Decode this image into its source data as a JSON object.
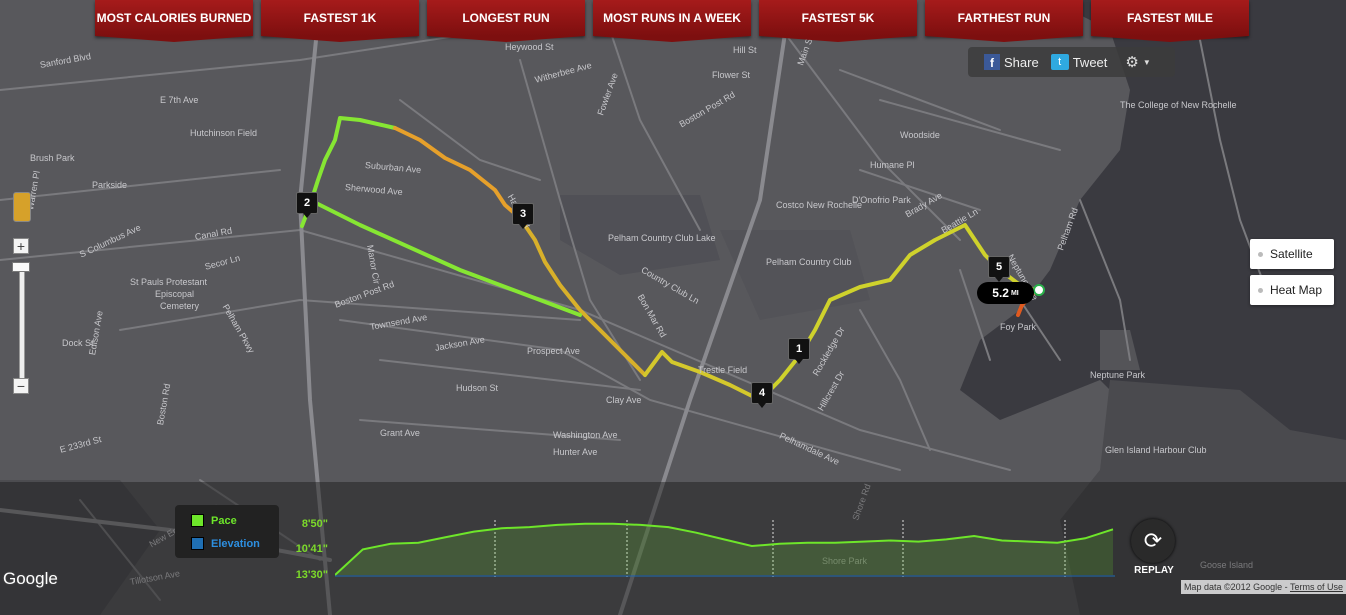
{
  "tabs": [
    "MOST CALORIES BURNED",
    "FASTEST 1K",
    "LONGEST RUN",
    "MOST RUNS IN A WEEK",
    "FASTEST 5K",
    "FARTHEST RUN",
    "FASTEST MILE"
  ],
  "share": {
    "facebook": "Share",
    "twitter": "Tweet"
  },
  "map_type": {
    "satellite": "Satellite",
    "heatmap": "Heat Map"
  },
  "zoom": {
    "plus": "+",
    "minus": "−"
  },
  "route": {
    "markers": [
      "1",
      "2",
      "3",
      "4",
      "5"
    ],
    "distance_value": "5.2",
    "distance_unit": "MI"
  },
  "map_labels": [
    "Sanford Blvd",
    "E 7th Ave",
    "Hutchinson Field",
    "Brush Park",
    "Parkside",
    "Warren Pl",
    "S Columbus Ave",
    "St Pauls Protestant",
    "Episcopal",
    "Cemetery",
    "Secor Ln",
    "Canal Rd",
    "Pelham Pkwy",
    "Dock St",
    "Edison Ave",
    "Boston Rd",
    "Grant Ave",
    "Suburban Ave",
    "Sherwood Ave",
    "Manor Cir",
    "Boston Post Rd",
    "Townsend Ave",
    "Jackson Ave",
    "Hudson St",
    "Prospect Ave",
    "Clay Ave",
    "Washington Ave",
    "Hunter Ave",
    "Hazen St",
    "Pelham Country Club Lake",
    "Pelham Country Club",
    "Country Club Ln",
    "Bon Mar Rd",
    "Trestle Field",
    "Pelhamdale Ave",
    "Hillcrest Dr",
    "Rockledge Dr",
    "Costco New Rochelle",
    "D'Onofrio Park",
    "Woodside",
    "Humane Pl",
    "Brady Ave",
    "Beattie Ln",
    "Neptune Ave",
    "Pelham Rd",
    "Foy Park",
    "Neptune Park",
    "Glen Island Harbour Club",
    "The College of New Rochelle",
    "Main St",
    "Hill St",
    "Flower St",
    "Boston Post Rd",
    "Heywood St",
    "Witherbee Ave",
    "Fowler Ave",
    "Shore Rd",
    "Shore Park",
    "Goose Island",
    "E 233rd St",
    "New England Thwy",
    "Tillotson Ave"
  ],
  "elevation": {
    "legend_pace": "Pace",
    "legend_elevation": "Elevation",
    "y_ticks": [
      "8'50\"",
      "10'41\"",
      "13'30\""
    ],
    "pace_values": [
      13.5,
      11.2,
      10.7,
      10.6,
      10.1,
      9.6,
      9.3,
      9.2,
      9.0,
      8.9,
      8.9,
      9.0,
      9.2,
      9.7,
      10.3,
      10.9,
      10.7,
      10.6,
      10.6,
      10.5,
      10.4,
      10.5,
      10.3,
      10.0,
      10.4,
      10.5,
      10.6,
      10.2,
      9.4
    ]
  },
  "replay_label": "REPLAY",
  "google_logo": "Google",
  "credits": {
    "data": "Map data ©2012 Google - ",
    "terms": "Terms of Use"
  },
  "colors": {
    "pace": "#6ee62a",
    "elevation": "#1f6fb3",
    "tab": "#9a1515"
  }
}
